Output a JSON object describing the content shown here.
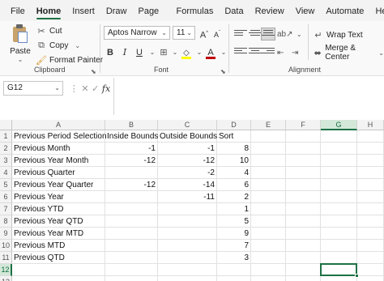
{
  "menu": {
    "tabs": [
      "File",
      "Home",
      "Insert",
      "Draw",
      "Page Layout",
      "Formulas",
      "Data",
      "Review",
      "View",
      "Automate",
      "Help"
    ],
    "active": "Home"
  },
  "ribbon": {
    "clipboard": {
      "label": "Clipboard",
      "paste": "Paste",
      "cut": "Cut",
      "copy": "Copy",
      "format_painter": "Format Painter"
    },
    "font": {
      "label": "Font",
      "font_name": "Aptos Narrow",
      "font_size": "11",
      "bold": "B",
      "italic": "I",
      "underline": "U",
      "grow": "A",
      "shrink": "A",
      "fill_color": "#ffff00",
      "font_color": "#c00000"
    },
    "alignment": {
      "label": "Alignment",
      "wrap_text": "Wrap Text",
      "merge_center": "Merge & Center"
    }
  },
  "formula_bar": {
    "name_box": "G12",
    "fx": "fx",
    "formula": ""
  },
  "sheet": {
    "columns": [
      "A",
      "B",
      "C",
      "D",
      "E",
      "F",
      "G",
      "H"
    ],
    "selected_column": "G",
    "row_numbers": [
      "1",
      "2",
      "3",
      "4",
      "5",
      "6",
      "7",
      "8",
      "9",
      "10",
      "11",
      "12",
      "13"
    ],
    "selected_row": "12",
    "rows": [
      [
        "Previous Period Selection",
        "Inside Bounds",
        "Outside Bounds",
        "Sort"
      ],
      [
        "Previous Month",
        "-1",
        "-1",
        "8"
      ],
      [
        "Previous Year Month",
        "-12",
        "-12",
        "10"
      ],
      [
        "Previous Quarter",
        "",
        "-2",
        "4"
      ],
      [
        "Previous Year Quarter",
        "-12",
        "-14",
        "6"
      ],
      [
        "Previous Year",
        "",
        "-11",
        "2"
      ],
      [
        "Previous YTD",
        "",
        "",
        "1"
      ],
      [
        "Previous Year QTD",
        "",
        "",
        "5"
      ],
      [
        "Previous Year MTD",
        "",
        "",
        "9"
      ],
      [
        "Previous MTD",
        "",
        "",
        "7"
      ],
      [
        "Previous QTD",
        "",
        "",
        "3"
      ],
      [
        "",
        "",
        "",
        ""
      ],
      [
        "",
        "",
        "",
        ""
      ]
    ]
  }
}
